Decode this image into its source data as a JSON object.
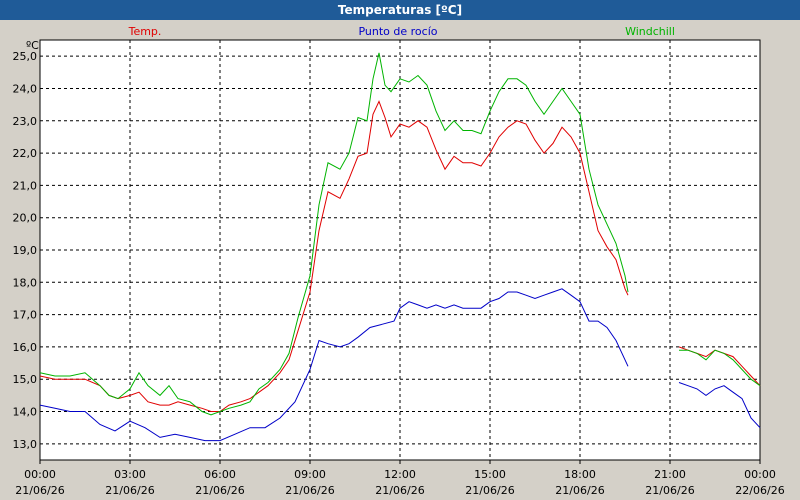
{
  "window": {
    "title": "Temperaturas [ºC]"
  },
  "chart_data": {
    "type": "line",
    "title": "Temperaturas [ºC]",
    "ylabel": "ºC",
    "ylim": [
      12.5,
      25.5
    ],
    "grid": true,
    "legend_placement": "top",
    "y_ticks": [
      "25,0",
      "24,0",
      "23,0",
      "22,0",
      "21,0",
      "20,0",
      "19,0",
      "18,0",
      "17,0",
      "16,0",
      "15,0",
      "14,0",
      "13,0"
    ],
    "x_ticks": [
      {
        "time": "00:00",
        "date": "21/06/26"
      },
      {
        "time": "03:00",
        "date": "21/06/26"
      },
      {
        "time": "06:00",
        "date": "21/06/26"
      },
      {
        "time": "09:00",
        "date": "21/06/26"
      },
      {
        "time": "12:00",
        "date": "21/06/26"
      },
      {
        "time": "15:00",
        "date": "21/06/26"
      },
      {
        "time": "18:00",
        "date": "21/06/26"
      },
      {
        "time": "21:00",
        "date": "21/06/26"
      },
      {
        "time": "00:00",
        "date": "22/06/26"
      }
    ],
    "series": [
      {
        "name": "Temp.",
        "color": "#e00000",
        "segments": [
          [
            [
              0,
              15.1
            ],
            [
              0.5,
              15.0
            ],
            [
              1.0,
              15.0
            ],
            [
              1.5,
              15.0
            ],
            [
              2.0,
              14.8
            ],
            [
              2.3,
              14.5
            ],
            [
              2.6,
              14.4
            ],
            [
              3.0,
              14.5
            ],
            [
              3.3,
              14.6
            ],
            [
              3.6,
              14.3
            ],
            [
              4.0,
              14.2
            ],
            [
              4.3,
              14.2
            ],
            [
              4.6,
              14.3
            ],
            [
              5.0,
              14.2
            ],
            [
              5.4,
              14.1
            ],
            [
              5.7,
              14.0
            ],
            [
              6.0,
              14.0
            ],
            [
              6.3,
              14.2
            ],
            [
              6.7,
              14.3
            ],
            [
              7.0,
              14.4
            ],
            [
              7.3,
              14.6
            ],
            [
              7.6,
              14.8
            ],
            [
              8.0,
              15.2
            ],
            [
              8.3,
              15.6
            ],
            [
              8.6,
              16.5
            ],
            [
              9.0,
              17.7
            ],
            [
              9.3,
              19.6
            ],
            [
              9.6,
              20.8
            ],
            [
              10.0,
              20.6
            ],
            [
              10.3,
              21.2
            ],
            [
              10.6,
              21.9
            ],
            [
              10.9,
              22.0
            ],
            [
              11.1,
              23.2
            ],
            [
              11.3,
              23.6
            ],
            [
              11.5,
              23.1
            ],
            [
              11.7,
              22.5
            ],
            [
              12.0,
              22.9
            ],
            [
              12.3,
              22.8
            ],
            [
              12.6,
              23.0
            ],
            [
              12.9,
              22.8
            ],
            [
              13.2,
              22.1
            ],
            [
              13.5,
              21.5
            ],
            [
              13.8,
              21.9
            ],
            [
              14.1,
              21.7
            ],
            [
              14.4,
              21.7
            ],
            [
              14.7,
              21.6
            ],
            [
              15.0,
              22.0
            ],
            [
              15.3,
              22.5
            ],
            [
              15.6,
              22.8
            ],
            [
              15.9,
              23.0
            ],
            [
              16.2,
              22.9
            ],
            [
              16.5,
              22.4
            ],
            [
              16.8,
              22.0
            ],
            [
              17.1,
              22.3
            ],
            [
              17.4,
              22.8
            ],
            [
              17.7,
              22.5
            ],
            [
              18.0,
              22.0
            ],
            [
              18.3,
              20.8
            ],
            [
              18.6,
              19.6
            ],
            [
              18.9,
              19.1
            ],
            [
              19.2,
              18.7
            ],
            [
              19.5,
              17.8
            ],
            [
              19.6,
              17.6
            ]
          ],
          [
            [
              21.3,
              16.0
            ],
            [
              21.6,
              15.9
            ],
            [
              21.9,
              15.8
            ],
            [
              22.2,
              15.7
            ],
            [
              22.5,
              15.9
            ],
            [
              22.8,
              15.8
            ],
            [
              23.1,
              15.7
            ],
            [
              23.4,
              15.4
            ],
            [
              23.7,
              15.1
            ],
            [
              24.0,
              14.8
            ]
          ]
        ]
      },
      {
        "name": "Punto de rocío",
        "color": "#0000c8",
        "segments": [
          [
            [
              0,
              14.2
            ],
            [
              0.5,
              14.1
            ],
            [
              1.0,
              14.0
            ],
            [
              1.5,
              14.0
            ],
            [
              2.0,
              13.6
            ],
            [
              2.5,
              13.4
            ],
            [
              3.0,
              13.7
            ],
            [
              3.5,
              13.5
            ],
            [
              4.0,
              13.2
            ],
            [
              4.5,
              13.3
            ],
            [
              5.0,
              13.2
            ],
            [
              5.5,
              13.1
            ],
            [
              6.0,
              13.1
            ],
            [
              6.5,
              13.3
            ],
            [
              7.0,
              13.5
            ],
            [
              7.5,
              13.5
            ],
            [
              8.0,
              13.8
            ],
            [
              8.5,
              14.3
            ],
            [
              9.0,
              15.3
            ],
            [
              9.3,
              16.2
            ],
            [
              9.6,
              16.1
            ],
            [
              10.0,
              16.0
            ],
            [
              10.3,
              16.1
            ],
            [
              10.6,
              16.3
            ],
            [
              11.0,
              16.6
            ],
            [
              11.4,
              16.7
            ],
            [
              11.8,
              16.8
            ],
            [
              12.0,
              17.2
            ],
            [
              12.3,
              17.4
            ],
            [
              12.6,
              17.3
            ],
            [
              12.9,
              17.2
            ],
            [
              13.2,
              17.3
            ],
            [
              13.5,
              17.2
            ],
            [
              13.8,
              17.3
            ],
            [
              14.1,
              17.2
            ],
            [
              14.4,
              17.2
            ],
            [
              14.7,
              17.2
            ],
            [
              15.0,
              17.4
            ],
            [
              15.3,
              17.5
            ],
            [
              15.6,
              17.7
            ],
            [
              15.9,
              17.7
            ],
            [
              16.2,
              17.6
            ],
            [
              16.5,
              17.5
            ],
            [
              16.8,
              17.6
            ],
            [
              17.1,
              17.7
            ],
            [
              17.4,
              17.8
            ],
            [
              17.7,
              17.6
            ],
            [
              18.0,
              17.4
            ],
            [
              18.3,
              16.8
            ],
            [
              18.6,
              16.8
            ],
            [
              18.9,
              16.6
            ],
            [
              19.2,
              16.2
            ],
            [
              19.5,
              15.6
            ],
            [
              19.6,
              15.4
            ]
          ],
          [
            [
              21.3,
              14.9
            ],
            [
              21.6,
              14.8
            ],
            [
              21.9,
              14.7
            ],
            [
              22.2,
              14.5
            ],
            [
              22.5,
              14.7
            ],
            [
              22.8,
              14.8
            ],
            [
              23.1,
              14.6
            ],
            [
              23.4,
              14.4
            ],
            [
              23.7,
              13.8
            ],
            [
              24.0,
              13.5
            ]
          ]
        ]
      },
      {
        "name": "Windchill",
        "color": "#00b400",
        "segments": [
          [
            [
              0,
              15.2
            ],
            [
              0.5,
              15.1
            ],
            [
              1.0,
              15.1
            ],
            [
              1.5,
              15.2
            ],
            [
              2.0,
              14.8
            ],
            [
              2.3,
              14.5
            ],
            [
              2.6,
              14.4
            ],
            [
              3.0,
              14.7
            ],
            [
              3.3,
              15.2
            ],
            [
              3.6,
              14.8
            ],
            [
              4.0,
              14.5
            ],
            [
              4.3,
              14.8
            ],
            [
              4.6,
              14.4
            ],
            [
              5.0,
              14.3
            ],
            [
              5.4,
              14.0
            ],
            [
              5.7,
              13.9
            ],
            [
              6.0,
              14.0
            ],
            [
              6.3,
              14.1
            ],
            [
              6.7,
              14.2
            ],
            [
              7.0,
              14.3
            ],
            [
              7.3,
              14.7
            ],
            [
              7.6,
              14.9
            ],
            [
              8.0,
              15.3
            ],
            [
              8.3,
              15.8
            ],
            [
              8.6,
              16.9
            ],
            [
              9.0,
              18.2
            ],
            [
              9.3,
              20.4
            ],
            [
              9.6,
              21.7
            ],
            [
              10.0,
              21.5
            ],
            [
              10.3,
              22.0
            ],
            [
              10.6,
              23.1
            ],
            [
              10.9,
              23.0
            ],
            [
              11.1,
              24.3
            ],
            [
              11.3,
              25.1
            ],
            [
              11.5,
              24.1
            ],
            [
              11.7,
              23.9
            ],
            [
              12.0,
              24.3
            ],
            [
              12.3,
              24.2
            ],
            [
              12.6,
              24.4
            ],
            [
              12.9,
              24.1
            ],
            [
              13.2,
              23.3
            ],
            [
              13.5,
              22.7
            ],
            [
              13.8,
              23.0
            ],
            [
              14.1,
              22.7
            ],
            [
              14.4,
              22.7
            ],
            [
              14.7,
              22.6
            ],
            [
              15.0,
              23.3
            ],
            [
              15.3,
              23.9
            ],
            [
              15.6,
              24.3
            ],
            [
              15.9,
              24.3
            ],
            [
              16.2,
              24.1
            ],
            [
              16.5,
              23.6
            ],
            [
              16.8,
              23.2
            ],
            [
              17.1,
              23.6
            ],
            [
              17.4,
              24.0
            ],
            [
              17.7,
              23.6
            ],
            [
              18.0,
              23.2
            ],
            [
              18.3,
              21.5
            ],
            [
              18.6,
              20.4
            ],
            [
              18.9,
              19.8
            ],
            [
              19.2,
              19.2
            ],
            [
              19.5,
              18.2
            ],
            [
              19.6,
              17.7
            ]
          ],
          [
            [
              21.3,
              15.9
            ],
            [
              21.6,
              15.9
            ],
            [
              21.9,
              15.8
            ],
            [
              22.2,
              15.6
            ],
            [
              22.5,
              15.9
            ],
            [
              22.8,
              15.8
            ],
            [
              23.1,
              15.6
            ],
            [
              23.4,
              15.3
            ],
            [
              23.7,
              15.0
            ],
            [
              24.0,
              14.8
            ]
          ]
        ]
      }
    ]
  }
}
